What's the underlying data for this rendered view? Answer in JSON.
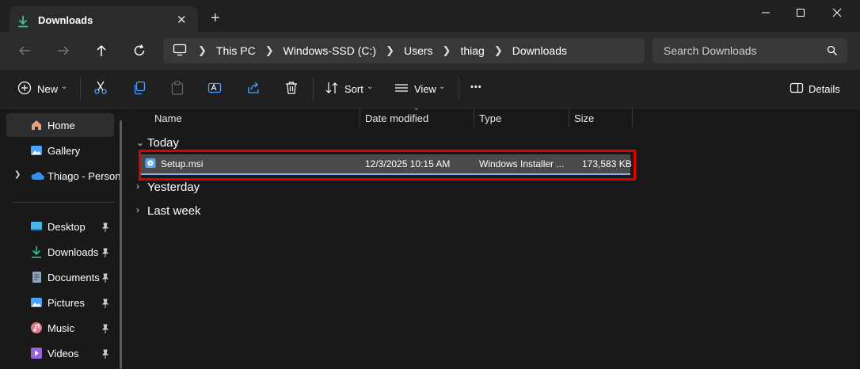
{
  "window": {
    "tab_title": "Downloads",
    "new_tab_label": "+"
  },
  "address": {
    "crumbs": [
      "This PC",
      "Windows-SSD (C:)",
      "Users",
      "thiag",
      "Downloads"
    ]
  },
  "search": {
    "placeholder": "Search Downloads"
  },
  "toolbar": {
    "new_label": "New",
    "sort_label": "Sort",
    "view_label": "View",
    "more_label": "•••",
    "details_label": "Details"
  },
  "sidebar": {
    "items": [
      {
        "label": "Home",
        "icon": "home-icon"
      },
      {
        "label": "Gallery",
        "icon": "gallery-icon"
      },
      {
        "label": "Thiago - Person",
        "icon": "onedrive-cloud-icon"
      }
    ],
    "quick": [
      {
        "label": "Desktop",
        "icon": "desktop-folder-icon"
      },
      {
        "label": "Downloads",
        "icon": "downloads-icon"
      },
      {
        "label": "Documents",
        "icon": "documents-icon"
      },
      {
        "label": "Pictures",
        "icon": "pictures-icon"
      },
      {
        "label": "Music",
        "icon": "music-icon"
      },
      {
        "label": "Videos",
        "icon": "videos-icon"
      }
    ]
  },
  "columns": {
    "name": "Name",
    "date": "Date modified",
    "type": "Type",
    "size": "Size"
  },
  "groups": {
    "today": "Today",
    "yesterday": "Yesterday",
    "last_week": "Last week"
  },
  "files": [
    {
      "name": "Setup.msi",
      "date": "12/3/2025 10:15 AM",
      "type": "Windows Installer ...",
      "size": "173,583 KB"
    }
  ],
  "colors": {
    "highlight_border": "#e00000",
    "selection_underline": "#8ab4f8",
    "accent_green": "#3dc48a"
  }
}
